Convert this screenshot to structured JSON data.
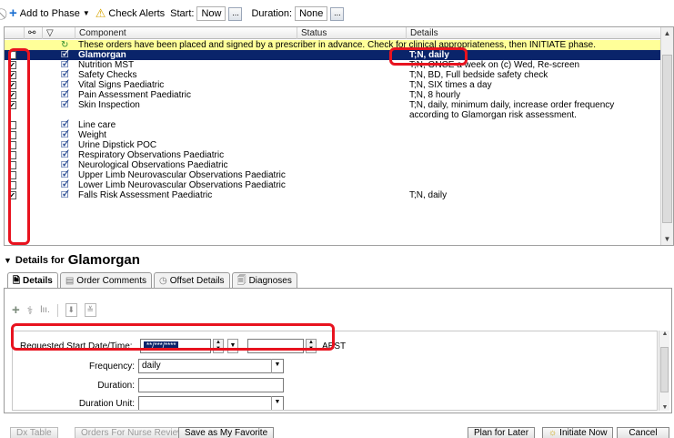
{
  "toolbar": {
    "add_to_phase": "Add to Phase",
    "check_alerts": "Check Alerts",
    "start_label": "Start:",
    "start_value": "Now",
    "duration_label": "Duration:",
    "duration_value": "None",
    "picker_glyph": "..."
  },
  "grid": {
    "columns": {
      "component": "Component",
      "status": "Status",
      "details": "Details"
    },
    "info_banner": "These orders have been placed and signed by a prescriber in advance. Check for clinical appropriateness, then INITIATE phase.",
    "rows": [
      {
        "checked": true,
        "component": "Glamorgan",
        "details": "T;N, daily",
        "selected": true
      },
      {
        "checked": true,
        "component": "Nutrition MST",
        "details": "T;N, ONCE a week on (c) Wed, Re-screen"
      },
      {
        "checked": true,
        "component": "Safety Checks",
        "details": "T;N, BD, Full bedside safety check"
      },
      {
        "checked": true,
        "component": "Vital Signs Paediatric",
        "details": "T;N, SIX times a day"
      },
      {
        "checked": true,
        "component": "Pain Assessment Paediatric",
        "details": "T;N, 8 hourly"
      },
      {
        "checked": true,
        "component": "Skin Inspection",
        "details": "T;N, daily, minimum daily, increase order frequency according to Glamorgan risk assessment."
      },
      {
        "checked": false,
        "component": "Line care",
        "details": ""
      },
      {
        "checked": false,
        "component": "Weight",
        "details": ""
      },
      {
        "checked": false,
        "component": "Urine Dipstick POC",
        "details": ""
      },
      {
        "checked": false,
        "component": "Respiratory Observations Paediatric",
        "details": ""
      },
      {
        "checked": false,
        "component": "Neurological Observations Paediatric",
        "details": ""
      },
      {
        "checked": false,
        "component": "Upper Limb Neurovascular Observations Paediatric",
        "details": ""
      },
      {
        "checked": false,
        "component": "Lower Limb Neurovascular Observations Paediatric",
        "details": ""
      },
      {
        "checked": true,
        "component": "Falls Risk Assessment Paediatric",
        "details": "T;N, daily"
      }
    ]
  },
  "details": {
    "header_label": "Details for",
    "order_name": "Glamorgan",
    "tabs": [
      "Details",
      "Order Comments",
      "Offset Details",
      "Diagnoses"
    ],
    "form": {
      "start_label": "Requested Start Date/Time:",
      "start_value": "**/***/****",
      "timezone": "AEST",
      "frequency_label": "Frequency:",
      "frequency_value": "daily",
      "duration_label": "Duration:",
      "duration_value": "",
      "duration_unit_label": "Duration Unit:",
      "duration_unit_value": ""
    }
  },
  "footer": {
    "dx_table": "Dx Table",
    "orders_for_nurse_review": "Orders For Nurse Review",
    "save_favorite": "Save as My Favorite",
    "plan_for_later": "Plan for Later",
    "initiate_now": "Initiate Now",
    "cancel": "Cancel"
  },
  "colors": {
    "highlight": "#e8131f",
    "selection": "#0a246a",
    "info_banner": "#ffff99"
  }
}
